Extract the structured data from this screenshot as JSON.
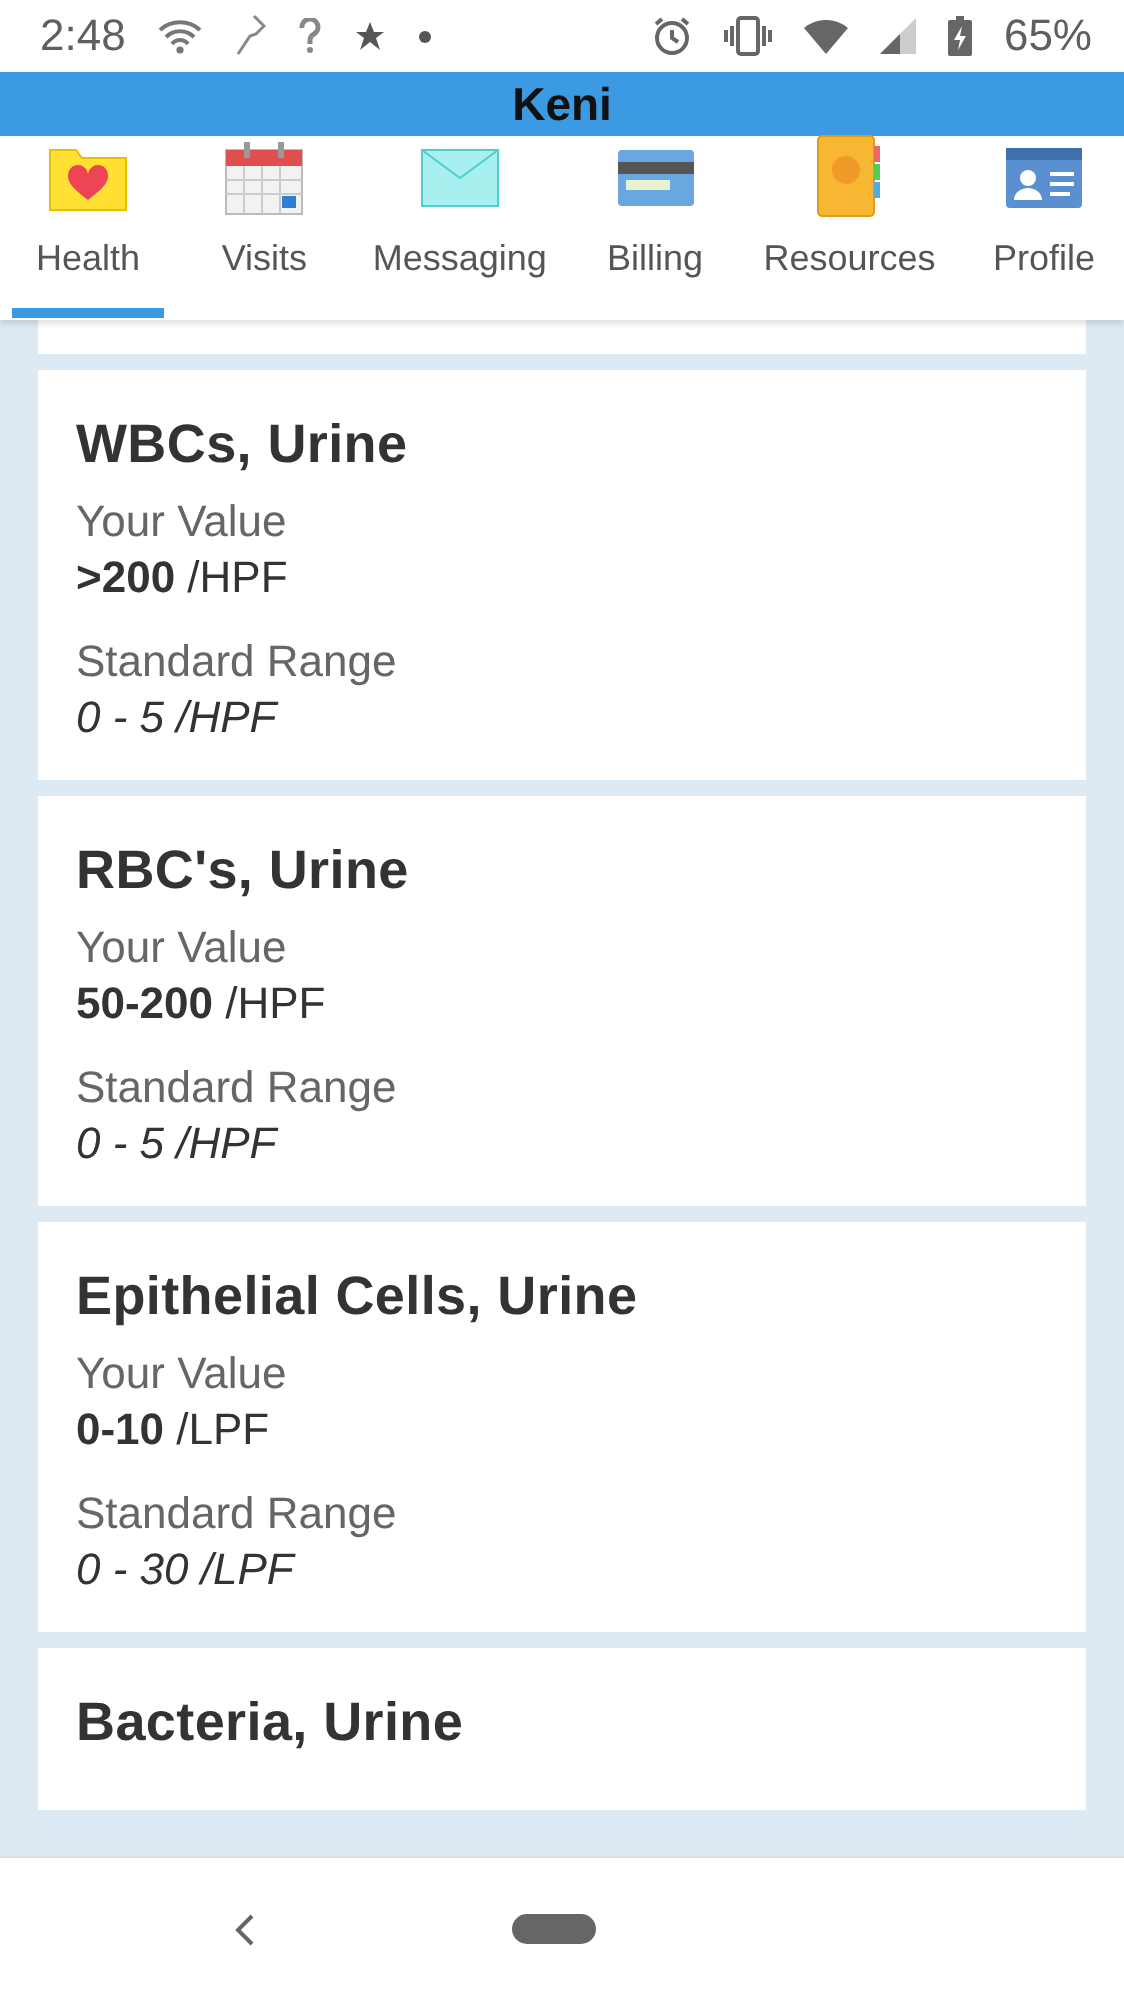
{
  "status_bar": {
    "time": "2:48",
    "battery": "65%"
  },
  "header": {
    "title": "Keni"
  },
  "tabs": [
    {
      "label": "Health",
      "selected": true
    },
    {
      "label": "Visits",
      "selected": false
    },
    {
      "label": "Messaging",
      "selected": false
    },
    {
      "label": "Billing",
      "selected": false
    },
    {
      "label": "Resources",
      "selected": false
    },
    {
      "label": "Profile",
      "selected": false
    }
  ],
  "results": [
    {
      "title": "WBCs, Urine",
      "value_label": "Your Value",
      "value": "**>200** /HPF",
      "range_label": "Standard Range",
      "range": "0 - 5 /HPF"
    },
    {
      "title": "RBC's, Urine",
      "value_label": "Your Value",
      "value": "**50-200** /HPF",
      "range_label": "Standard Range",
      "range": "0 - 5 /HPF"
    },
    {
      "title": "Epithelial Cells, Urine",
      "value_label": "Your Value",
      "value": "**0-10** /LPF",
      "range_label": "Standard Range",
      "range": "0 - 30 /LPF"
    },
    {
      "title": "Bacteria, Urine"
    }
  ]
}
